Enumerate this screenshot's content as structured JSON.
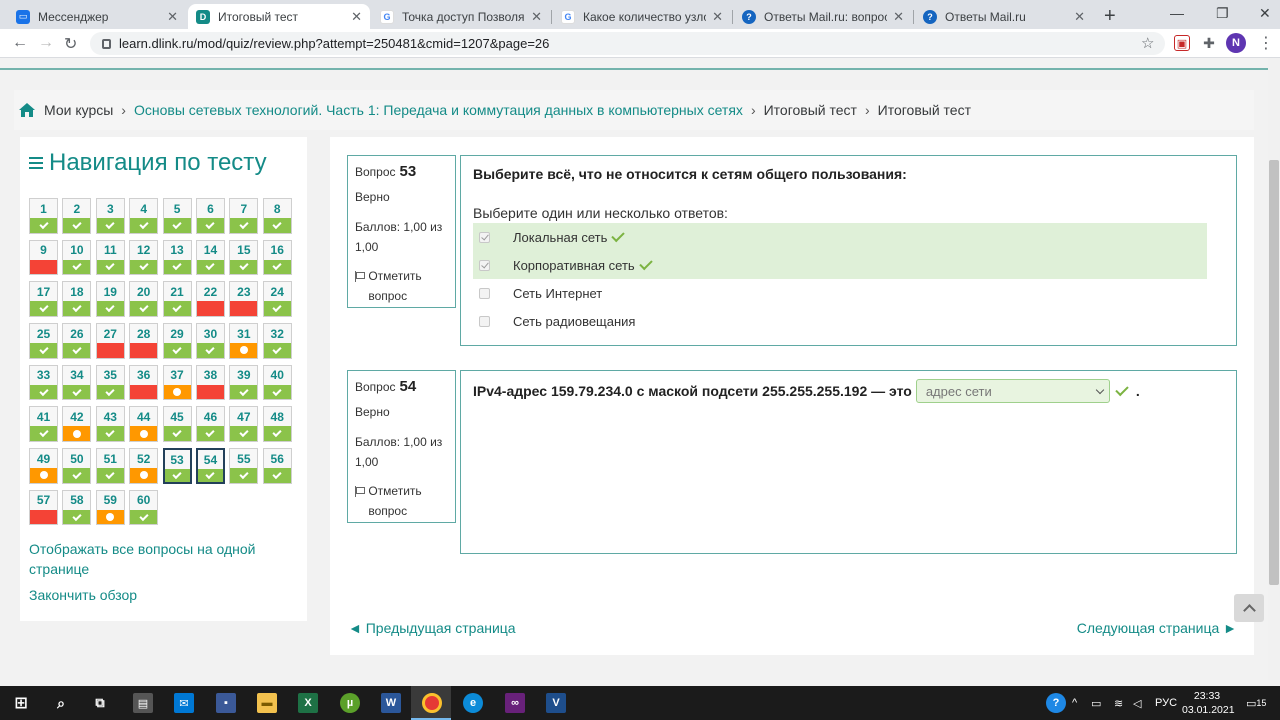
{
  "browser": {
    "tabs": [
      {
        "title": "Мессенджер",
        "icon": "messenger-icon",
        "color": "#1a73e8"
      },
      {
        "title": "Итоговый тест",
        "icon": "dlink-icon",
        "color": "#148b87",
        "active": true
      },
      {
        "title": "Точка доступ Позволяет об",
        "icon": "google-icon",
        "color": "#ffffff"
      },
      {
        "title": "Какое количество узлов до",
        "icon": "google-icon",
        "color": "#ffffff"
      },
      {
        "title": "Ответы Mail.ru: вопрос",
        "icon": "mailru-answers-icon",
        "color": "#1565c0"
      },
      {
        "title": "Ответы Mail.ru",
        "icon": "mailru-answers-icon",
        "color": "#1565c0"
      }
    ],
    "url": "learn.dlink.ru/mod/quiz/review.php?attempt=250481&cmid=1207&page=26",
    "profile_initial": "N"
  },
  "breadcrumb": {
    "items": [
      "Мои курсы",
      "Основы сетевых технологий. Часть 1: Передача и коммутация данных в компьютерных сетях",
      "Итоговый тест",
      "Итоговый тест"
    ]
  },
  "quiz_nav": {
    "title": "Навигация по тесту",
    "questions": [
      {
        "n": "1",
        "s": "correct"
      },
      {
        "n": "2",
        "s": "correct"
      },
      {
        "n": "3",
        "s": "correct"
      },
      {
        "n": "4",
        "s": "correct"
      },
      {
        "n": "5",
        "s": "correct"
      },
      {
        "n": "6",
        "s": "correct"
      },
      {
        "n": "7",
        "s": "correct"
      },
      {
        "n": "8",
        "s": "correct"
      },
      {
        "n": "9",
        "s": "wrong"
      },
      {
        "n": "10",
        "s": "correct"
      },
      {
        "n": "11",
        "s": "correct"
      },
      {
        "n": "12",
        "s": "correct"
      },
      {
        "n": "13",
        "s": "correct"
      },
      {
        "n": "14",
        "s": "correct"
      },
      {
        "n": "15",
        "s": "correct"
      },
      {
        "n": "16",
        "s": "correct"
      },
      {
        "n": "17",
        "s": "correct"
      },
      {
        "n": "18",
        "s": "correct"
      },
      {
        "n": "19",
        "s": "correct"
      },
      {
        "n": "20",
        "s": "correct"
      },
      {
        "n": "21",
        "s": "correct"
      },
      {
        "n": "22",
        "s": "wrong"
      },
      {
        "n": "23",
        "s": "wrong"
      },
      {
        "n": "24",
        "s": "correct"
      },
      {
        "n": "25",
        "s": "correct"
      },
      {
        "n": "26",
        "s": "correct"
      },
      {
        "n": "27",
        "s": "wrong"
      },
      {
        "n": "28",
        "s": "wrong"
      },
      {
        "n": "29",
        "s": "correct"
      },
      {
        "n": "30",
        "s": "correct"
      },
      {
        "n": "31",
        "s": "partial"
      },
      {
        "n": "32",
        "s": "correct"
      },
      {
        "n": "33",
        "s": "correct"
      },
      {
        "n": "34",
        "s": "correct"
      },
      {
        "n": "35",
        "s": "correct"
      },
      {
        "n": "36",
        "s": "wrong"
      },
      {
        "n": "37",
        "s": "partial"
      },
      {
        "n": "38",
        "s": "wrong"
      },
      {
        "n": "39",
        "s": "correct"
      },
      {
        "n": "40",
        "s": "correct"
      },
      {
        "n": "41",
        "s": "correct"
      },
      {
        "n": "42",
        "s": "partial"
      },
      {
        "n": "43",
        "s": "correct"
      },
      {
        "n": "44",
        "s": "partial"
      },
      {
        "n": "45",
        "s": "correct"
      },
      {
        "n": "46",
        "s": "correct"
      },
      {
        "n": "47",
        "s": "correct"
      },
      {
        "n": "48",
        "s": "correct"
      },
      {
        "n": "49",
        "s": "partial"
      },
      {
        "n": "50",
        "s": "correct"
      },
      {
        "n": "51",
        "s": "correct"
      },
      {
        "n": "52",
        "s": "partial"
      },
      {
        "n": "53",
        "s": "correct",
        "current": true
      },
      {
        "n": "54",
        "s": "correct",
        "current": true
      },
      {
        "n": "55",
        "s": "correct"
      },
      {
        "n": "56",
        "s": "correct"
      },
      {
        "n": "57",
        "s": "wrong"
      },
      {
        "n": "58",
        "s": "correct"
      },
      {
        "n": "59",
        "s": "partial"
      },
      {
        "n": "60",
        "s": "correct"
      }
    ],
    "show_all_link": "Отображать все вопросы на одной странице",
    "finish_link": "Закончить обзор"
  },
  "questions": [
    {
      "label": "Вопрос",
      "number": "53",
      "state": "Верно",
      "grade": "Баллов: 1,00 из 1,00",
      "flag": "Отметить вопрос",
      "text": "Выберите всё, что не относится к сетям общего пользования:",
      "prompt": "Выберите один или несколько ответов:",
      "answers": [
        {
          "label": "Локальная сеть",
          "checked": true,
          "correct": true
        },
        {
          "label": "Корпоративная сеть",
          "checked": true,
          "correct": true
        },
        {
          "label": "Сеть Интернет",
          "checked": false,
          "correct": false
        },
        {
          "label": "Сеть радиовещания",
          "checked": false,
          "correct": false
        }
      ]
    },
    {
      "label": "Вопрос",
      "number": "54",
      "state": "Верно",
      "grade": "Баллов: 1,00 из 1,00",
      "flag": "Отметить вопрос",
      "text": "IPv4-адрес 159.79.234.0 с маской подсети 255.255.255.192 — это",
      "selected": "адрес сети",
      "after": "."
    }
  ],
  "pager": {
    "prev": "◄ Предыдущая страница",
    "next": "Следующая страница ►"
  },
  "taskbar": {
    "lang": "РУС",
    "time": "23:33",
    "date": "03.01.2021",
    "notifications": "15"
  },
  "colors": {
    "accent": "#148b87",
    "correct": "#8bc34a",
    "wrong": "#f44336",
    "partial": "#ff9800"
  }
}
